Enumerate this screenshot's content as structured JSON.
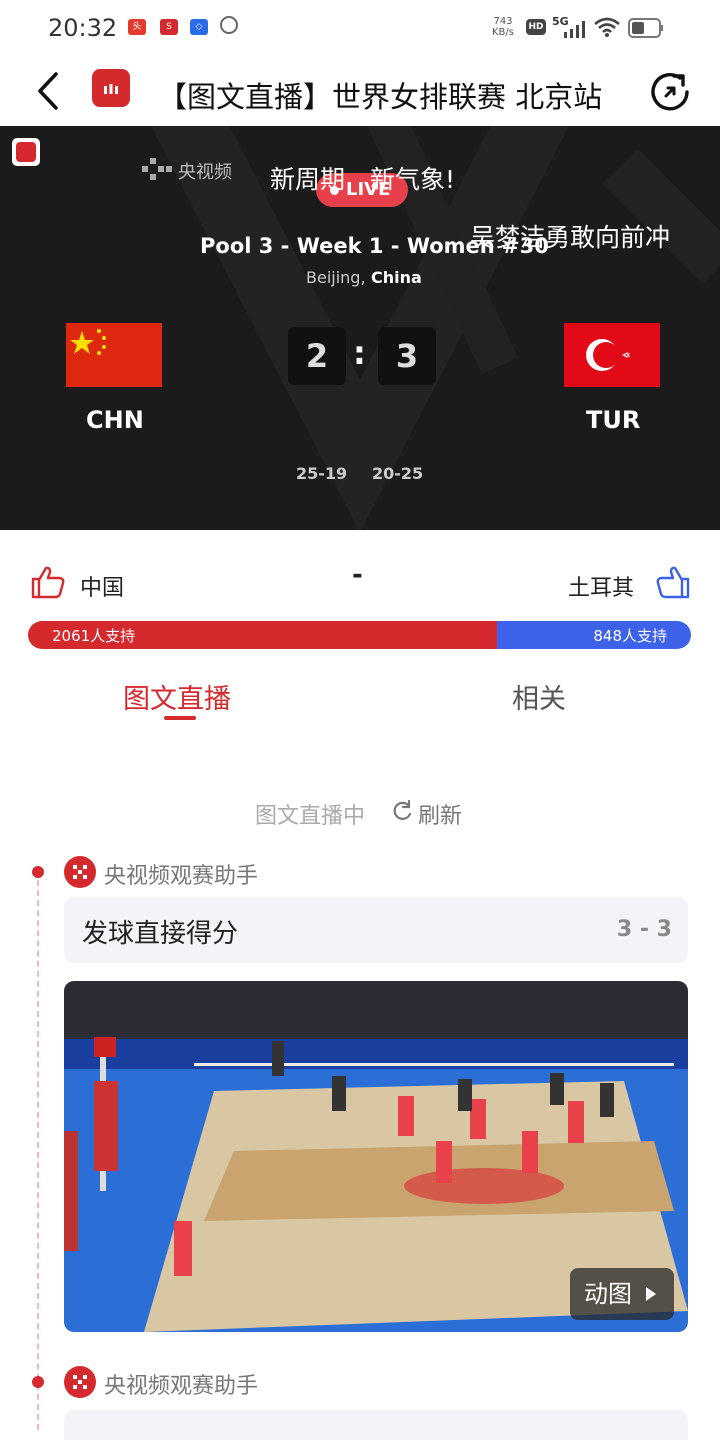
{
  "status_bar": {
    "time": "20:32",
    "net_speed_value": "743",
    "net_speed_unit": "KB/s",
    "hd": "HD",
    "signal": "5G",
    "app_icons": [
      "toutiao-app-icon",
      "sports-app-icon",
      "baidu-app-icon",
      "browser-app-icon"
    ]
  },
  "nav": {
    "title": "【图文直播】世界女排联赛 北京站",
    "back_icon": "chevron-left-icon",
    "app_icon": "cctv-sports-app-icon",
    "share_icon": "share-arrow-icon"
  },
  "video": {
    "corner_logo": "cctv-sports-logo",
    "watermark": "央视频",
    "caption1": "新周期　新气象!",
    "live_label": "LIVE",
    "caption2": "吴梦洁勇敢向前冲",
    "match_title": "Pool 3 - Week 1 - Women #30",
    "location_city": "Beijing,",
    "location_country": "China",
    "team_left": "CHN",
    "team_right": "TUR",
    "score_left": "2",
    "score_sep": ":",
    "score_right": "3",
    "set1": "25-19",
    "set2": "20-25"
  },
  "support": {
    "team_left": "中国",
    "team_right": "土耳其",
    "divider": "-",
    "left_count": "2061人支持",
    "right_count": "848人支持",
    "left_share": 0.708,
    "left_color": "#d42a2e",
    "right_color": "#3d61e8"
  },
  "tabs": [
    {
      "label": "图文直播",
      "active": true
    },
    {
      "label": "相关",
      "active": false
    }
  ],
  "feed": {
    "status": "图文直播中",
    "refresh": "刷新",
    "items": [
      {
        "source": "央视频观赛助手",
        "text": "发球直接得分",
        "score": "3 - 3",
        "media_badge": "动图"
      },
      {
        "source": "央视频观赛助手"
      }
    ]
  },
  "colors": {
    "accent": "#d42a2e",
    "blue": "#3d61e8"
  }
}
